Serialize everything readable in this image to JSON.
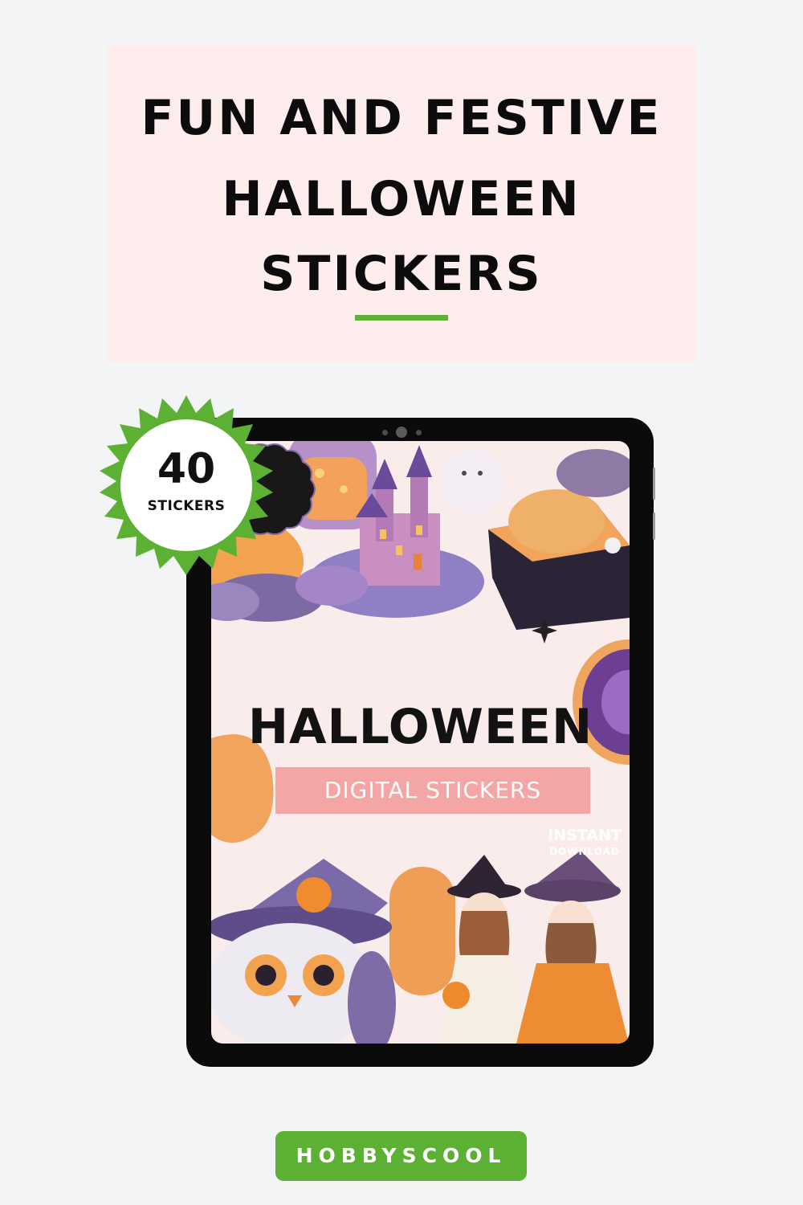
{
  "header": {
    "title_lines": [
      "FUN AND FESTIVE",
      "HALLOWEEN",
      "STICKERS"
    ],
    "underline_color": "#5fb133"
  },
  "badge": {
    "count": "40",
    "label": "STICKERS",
    "color": "#5cb033"
  },
  "product": {
    "title": "HALLOWEEN",
    "subtitle": "DIGITAL STICKERS",
    "instant_label": "INSTANT",
    "download_label": "DOWNLOAD"
  },
  "brand": {
    "name": "HOBBYSCOOL",
    "color": "#5cb033"
  }
}
